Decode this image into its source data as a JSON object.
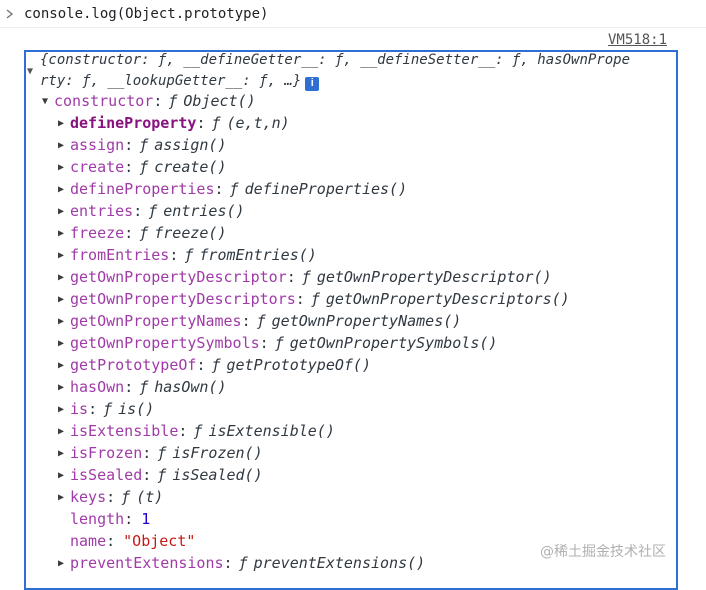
{
  "command": {
    "chevron_icon": "chevron-right-icon",
    "text": "console.log(Object.prototype)"
  },
  "source_link": "VM518:1",
  "summary": {
    "line1": "{constructor: ƒ, __defineGetter__: ƒ, __defineSetter__: ƒ, hasOwnPrope",
    "line2": "rty: ƒ, __lookupGetter__: ƒ, …}",
    "info_icon": "i"
  },
  "constructor": {
    "key": "constructor",
    "fsym": "ƒ",
    "value": "Object()"
  },
  "properties": [
    {
      "key": "defineProperty",
      "own": true,
      "fsym": "ƒ",
      "value": "(e,t,n)"
    },
    {
      "key": "assign",
      "fsym": "ƒ",
      "value": "assign()"
    },
    {
      "key": "create",
      "fsym": "ƒ",
      "value": "create()"
    },
    {
      "key": "defineProperties",
      "fsym": "ƒ",
      "value": "defineProperties()"
    },
    {
      "key": "entries",
      "fsym": "ƒ",
      "value": "entries()"
    },
    {
      "key": "freeze",
      "fsym": "ƒ",
      "value": "freeze()"
    },
    {
      "key": "fromEntries",
      "fsym": "ƒ",
      "value": "fromEntries()"
    },
    {
      "key": "getOwnPropertyDescriptor",
      "fsym": "ƒ",
      "value": "getOwnPropertyDescriptor()"
    },
    {
      "key": "getOwnPropertyDescriptors",
      "fsym": "ƒ",
      "value": "getOwnPropertyDescriptors()"
    },
    {
      "key": "getOwnPropertyNames",
      "fsym": "ƒ",
      "value": "getOwnPropertyNames()"
    },
    {
      "key": "getOwnPropertySymbols",
      "fsym": "ƒ",
      "value": "getOwnPropertySymbols()"
    },
    {
      "key": "getPrototypeOf",
      "fsym": "ƒ",
      "value": "getPrototypeOf()"
    },
    {
      "key": "hasOwn",
      "fsym": "ƒ",
      "value": "hasOwn()"
    },
    {
      "key": "is",
      "fsym": "ƒ",
      "value": "is()"
    },
    {
      "key": "isExtensible",
      "fsym": "ƒ",
      "value": "isExtensible()"
    },
    {
      "key": "isFrozen",
      "fsym": "ƒ",
      "value": "isFrozen()"
    },
    {
      "key": "isSealed",
      "fsym": "ƒ",
      "value": "isSealed()"
    },
    {
      "key": "keys",
      "fsym": "ƒ",
      "value": "(t)"
    },
    {
      "key": "length",
      "kind": "number",
      "value": "1"
    },
    {
      "key": "name",
      "kind": "string",
      "value": "\"Object\""
    },
    {
      "key": "preventExtensions",
      "fsym": "ƒ",
      "value": "preventExtensions()"
    }
  ],
  "watermark": "@稀土掘金技术社区",
  "colors": {
    "highlight_border": "#2d6fd2",
    "key": "#a03aa8",
    "number": "#1c00cf",
    "string": "#c41a16"
  }
}
